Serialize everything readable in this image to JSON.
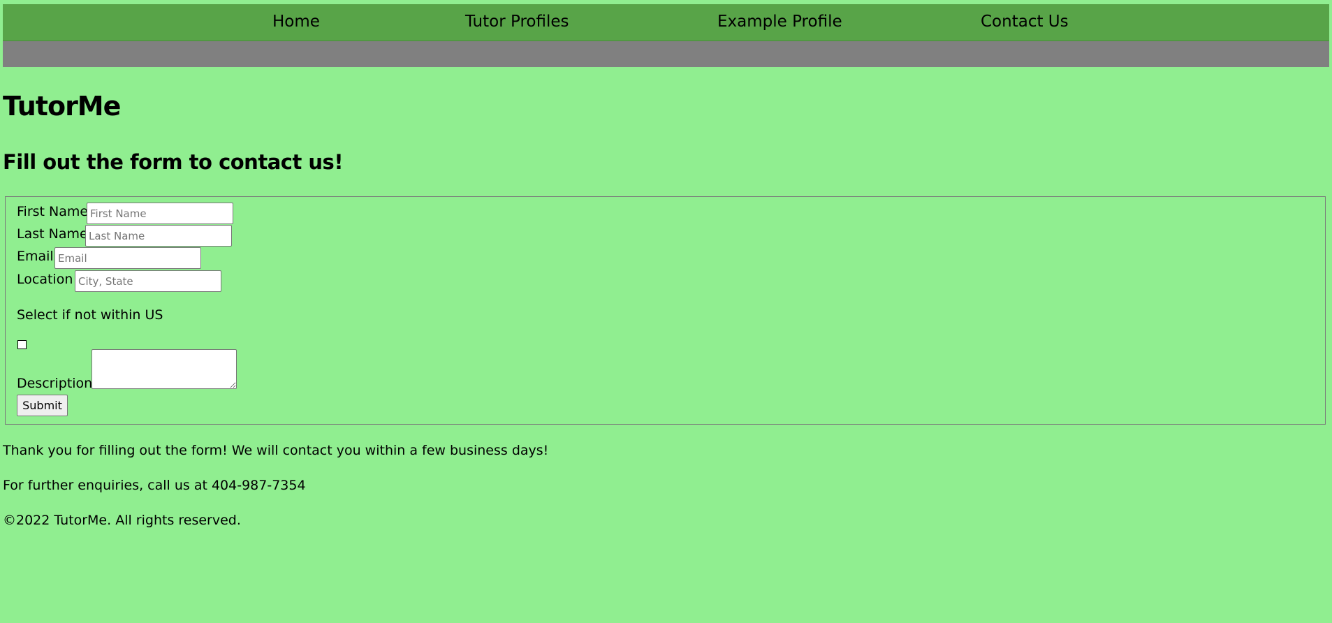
{
  "nav": {
    "items": [
      {
        "label": "Home"
      },
      {
        "label": "Tutor Profiles"
      },
      {
        "label": "Example Profile"
      },
      {
        "label": "Contact Us"
      }
    ]
  },
  "header": {
    "title": "TutorMe",
    "subtitle": "Fill out the form to contact us!"
  },
  "form": {
    "first_name": {
      "label": "First Name",
      "placeholder": "First Name",
      "value": ""
    },
    "last_name": {
      "label": "Last Name",
      "placeholder": "Last Name",
      "value": ""
    },
    "email": {
      "label": "Email",
      "placeholder": "Email",
      "value": ""
    },
    "location": {
      "label": "Location",
      "placeholder": "City, State",
      "value": ""
    },
    "not_us": {
      "label": "Select if not within US",
      "checked": false
    },
    "description": {
      "label": "Description",
      "value": ""
    },
    "submit_label": "Submit"
  },
  "footer": {
    "thank_you": "Thank you for filling out the form! We will contact you within a few business days!",
    "enquiries": "For further enquiries, call us at 404-987-7354",
    "copyright": "©2022 TutorMe. All rights reserved."
  },
  "colors": {
    "page_background": "#90ee90",
    "navbar": "#58a448",
    "subbar": "#808080"
  }
}
